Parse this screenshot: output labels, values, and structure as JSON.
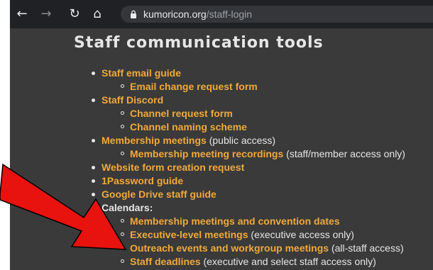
{
  "browser": {
    "url_host": "kumoricon.org",
    "url_path": "/staff-login"
  },
  "page": {
    "title": "Staff communication tools"
  },
  "items": [
    {
      "link": "Staff email guide",
      "note": "",
      "children": [
        {
          "link": "Email change request form",
          "note": ""
        }
      ]
    },
    {
      "link": "Staff Discord",
      "note": "",
      "children": [
        {
          "link": "Channel request form",
          "note": ""
        },
        {
          "link": "Channel naming scheme",
          "note": ""
        }
      ]
    },
    {
      "link": "Membership meetings",
      "note": " (public access)",
      "children": [
        {
          "link": "Membership meeting recordings",
          "note": " (staff/member access only)"
        }
      ]
    },
    {
      "link": "Website form creation request",
      "note": "",
      "children": []
    },
    {
      "link": "1Password guide",
      "note": "",
      "children": []
    },
    {
      "link": "Google Drive staff guide",
      "note": "",
      "children": []
    },
    {
      "label": "Calendars:",
      "children": [
        {
          "link": "Membership meetings and convention dates",
          "note": ""
        },
        {
          "link": "Executive-level meetings",
          "note": " (executive access only)"
        },
        {
          "link": "Outreach events and workgroup meetings",
          "note": " (all-staff access)"
        },
        {
          "link": "Staff deadlines",
          "note": " (executive and select staff access only)"
        }
      ]
    }
  ],
  "colors": {
    "link": "#f0a93a",
    "background": "#3a3a3a",
    "arrow": "#e8120e"
  },
  "icons": [
    "back-arrow-icon",
    "forward-arrow-icon",
    "reload-icon",
    "home-icon",
    "lock-icon"
  ]
}
